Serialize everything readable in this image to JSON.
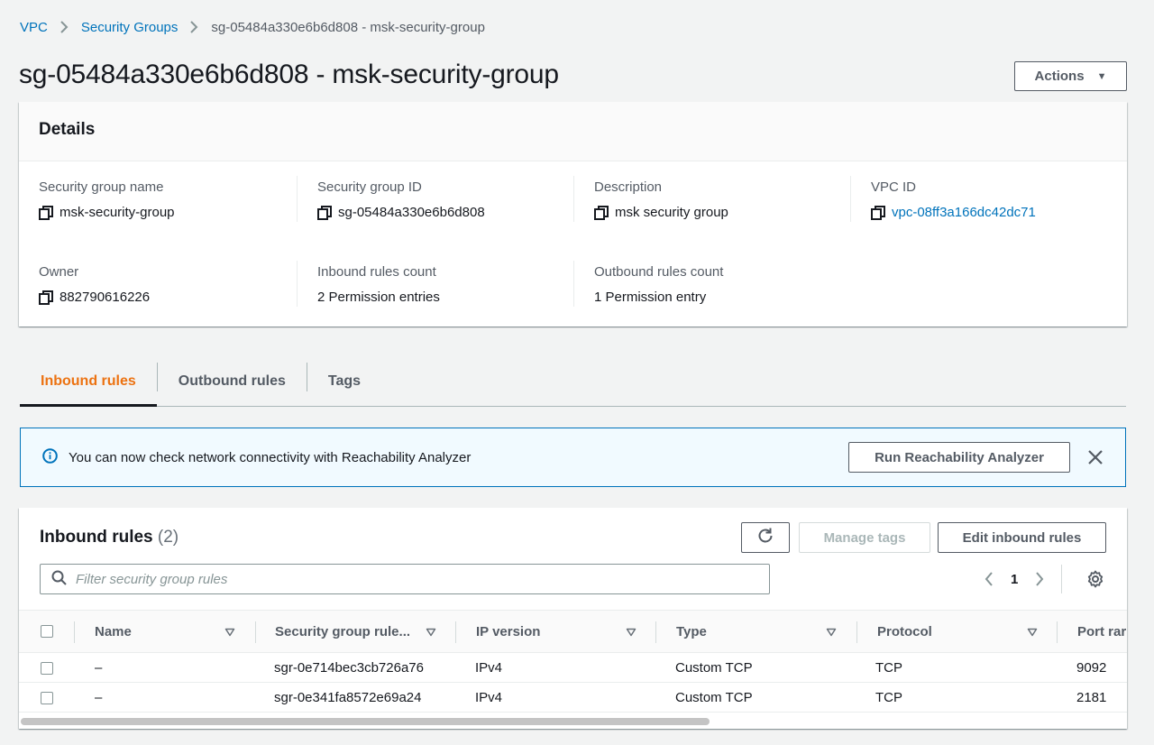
{
  "breadcrumb": {
    "items": [
      "VPC",
      "Security Groups"
    ],
    "current": "sg-05484a330e6b6d808 - msk-security-group"
  },
  "page": {
    "title": "sg-05484a330e6b6d808 - msk-security-group",
    "actions_label": "Actions"
  },
  "details": {
    "heading": "Details",
    "fields": [
      {
        "label": "Security group name",
        "value": "msk-security-group"
      },
      {
        "label": "Security group ID",
        "value": "sg-05484a330e6b6d808"
      },
      {
        "label": "Description",
        "value": "msk security group"
      },
      {
        "label": "VPC ID",
        "value": "vpc-08ff3a166dc42dc71"
      },
      {
        "label": "Owner",
        "value": "882790616226"
      },
      {
        "label": "Inbound rules count",
        "value": "2 Permission entries"
      },
      {
        "label": "Outbound rules count",
        "value": "1 Permission entry"
      }
    ]
  },
  "tabs": [
    {
      "label": "Inbound rules",
      "active": true
    },
    {
      "label": "Outbound rules",
      "active": false
    },
    {
      "label": "Tags",
      "active": false
    }
  ],
  "flash": {
    "message": "You can now check network connectivity with Reachability Analyzer",
    "button_label": "Run Reachability Analyzer"
  },
  "inbound": {
    "title": "Inbound rules",
    "count": "(2)",
    "manage_tags_label": "Manage tags",
    "edit_label": "Edit inbound rules",
    "filter_placeholder": "Filter security group rules",
    "page": "1",
    "columns": [
      "Name",
      "Security group rule...",
      "IP version",
      "Type",
      "Protocol",
      "Port rar"
    ],
    "rows": [
      [
        "–",
        "sgr-0e714bec3cb726a76",
        "IPv4",
        "Custom TCP",
        "TCP",
        "9092"
      ],
      [
        "–",
        "sgr-0e341fa8572e69a24",
        "IPv4",
        "Custom TCP",
        "TCP",
        "2181"
      ]
    ]
  },
  "colors": {
    "link": "#0073bb",
    "active_tab": "#ec7211",
    "info_bg": "#f1faff"
  }
}
